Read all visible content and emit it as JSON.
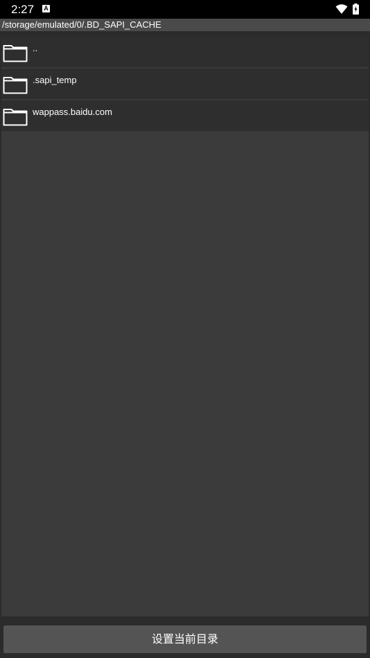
{
  "status_bar": {
    "time": "2:27",
    "notification_badge": "A",
    "icons": [
      "wifi-icon",
      "battery-icon"
    ]
  },
  "path": "/storage/emulated/0/.BD_SAPI_CACHE",
  "entries": [
    {
      "name": "..",
      "icon": "folder-icon"
    },
    {
      "name": ".sapi_temp",
      "icon": "folder-icon"
    },
    {
      "name": "wappass.baidu.com",
      "icon": "folder-icon"
    }
  ],
  "action_button": {
    "label": "设置当前目录"
  },
  "colors": {
    "background": "#2b2b2b",
    "list_background": "#3b3b3b",
    "row_background": "#2e2e2e",
    "path_bar": "#4a4a4a",
    "button": "#545454"
  }
}
